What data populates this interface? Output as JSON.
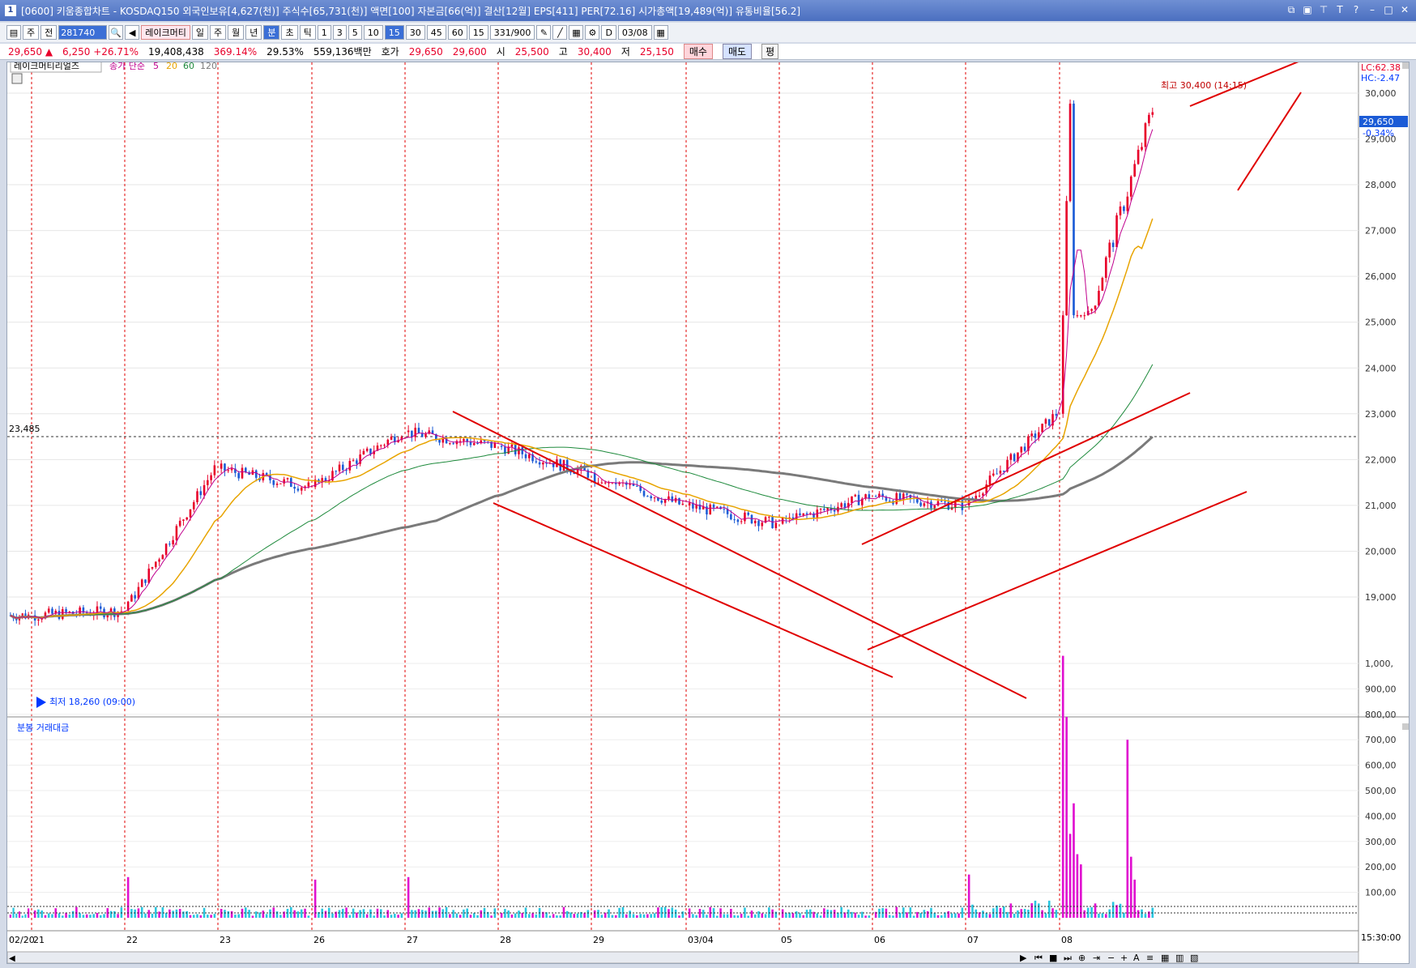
{
  "window": {
    "badge": "1",
    "title": "[0600] 키움종합차트 - KOSDAQ150 외국인보유[4,627(천)] 주식수[65,731(천)] 액면[100] 자본금[66(억)] 결산[12월] EPS[411] PER[72.16] 시가총액[19,489(억)] 유통비율[56.2]"
  },
  "toolbar": {
    "items": [
      "주",
      "전",
      "281740",
      "레이크머티",
      "일",
      "주",
      "월",
      "년",
      "분",
      "초",
      "틱",
      "1",
      "3",
      "5",
      "10",
      "15",
      "30",
      "45",
      "60",
      "15",
      "331/900",
      "D",
      "03/08"
    ],
    "selected": [
      "분",
      "15"
    ]
  },
  "quote": {
    "price": "29,650",
    "change": "6,250",
    "change_pct": "+26.71%",
    "volume": "19,408,438",
    "vol_ratio": "369.14%",
    "turnover": "29.53%",
    "amount": "559,136백만",
    "label_hoga": "호가",
    "ask": "29,650",
    "bid": "29,600",
    "label_open": "시",
    "open": "25,500",
    "label_high": "고",
    "high": "30,400",
    "label_low": "저",
    "low": "25,150",
    "buy": "매수",
    "sell": "매도",
    "extra": "평"
  },
  "legend": {
    "stock_name": "레이크머티리얼즈",
    "ma_title": "종가 단순",
    "ma_periods": [
      "5",
      "20",
      "60",
      "120"
    ],
    "ma_colors": [
      "#c0008e",
      "#e8a400",
      "#1e8a3c",
      "#7a7a7a"
    ]
  },
  "annotations": {
    "high_label": "최고 30,400 (14:15)",
    "low_label": "최저 18,260 (09:00)",
    "ref_level": "23,485",
    "lc": "LC:62.38",
    "hc": "HC:-2.47",
    "current_price": "29,650",
    "current_pct": "-0.34%"
  },
  "volume_panel": {
    "title": "분봉 거래대금"
  },
  "chart_data": [
    {
      "type": "candlestick",
      "title": "",
      "series": [
        {
          "name": "5",
          "color": "#c0008e"
        },
        {
          "name": "20",
          "color": "#e8a400"
        },
        {
          "name": "60",
          "color": "#1e8a3c"
        },
        {
          "name": "120",
          "color": "#7a7a7a"
        }
      ],
      "x_ticks": [
        "02/20",
        "21",
        "22",
        "23",
        "26",
        "27",
        "28",
        "29",
        "03/04",
        "05",
        "06",
        "07",
        "08"
      ],
      "y_ticks": [
        "19,000",
        "20,000",
        "21,000",
        "22,000",
        "23,000",
        "24,000",
        "25,000",
        "26,000",
        "27,000",
        "28,000",
        "29,000",
        "30,000"
      ],
      "ylim": [
        18000,
        30800
      ],
      "time_label": "15:30:00",
      "day_closes": [
        18600,
        18700,
        21800,
        21400,
        22600,
        22300,
        21700,
        21000,
        20600,
        21200,
        21000,
        23000,
        29650
      ],
      "day_highs": [
        18900,
        19100,
        22500,
        22200,
        23500,
        23900,
        22400,
        21500,
        21200,
        22000,
        21400,
        23600,
        30400
      ],
      "day_lows": [
        18260,
        18400,
        18900,
        20800,
        21500,
        21400,
        20900,
        20500,
        19700,
        20700,
        20800,
        20900,
        25150
      ]
    },
    {
      "type": "bar",
      "title": "",
      "y_ticks": [
        "100,00",
        "200,00",
        "300,00",
        "400,00",
        "500,00",
        "600,00",
        "700,00",
        "800,00",
        "900,00",
        "1,000,"
      ],
      "ylim": [
        0,
        1050
      ],
      "spikes": [
        {
          "day": "22",
          "value": 160
        },
        {
          "day": "26",
          "value": 150
        },
        {
          "day": "27",
          "value": 160
        },
        {
          "day": "07",
          "value": 170
        },
        {
          "day": "08",
          "value": 1030
        },
        {
          "day": "08",
          "value": 790
        },
        {
          "day": "08",
          "value": 450
        },
        {
          "day": "08",
          "value": 700
        }
      ]
    }
  ]
}
